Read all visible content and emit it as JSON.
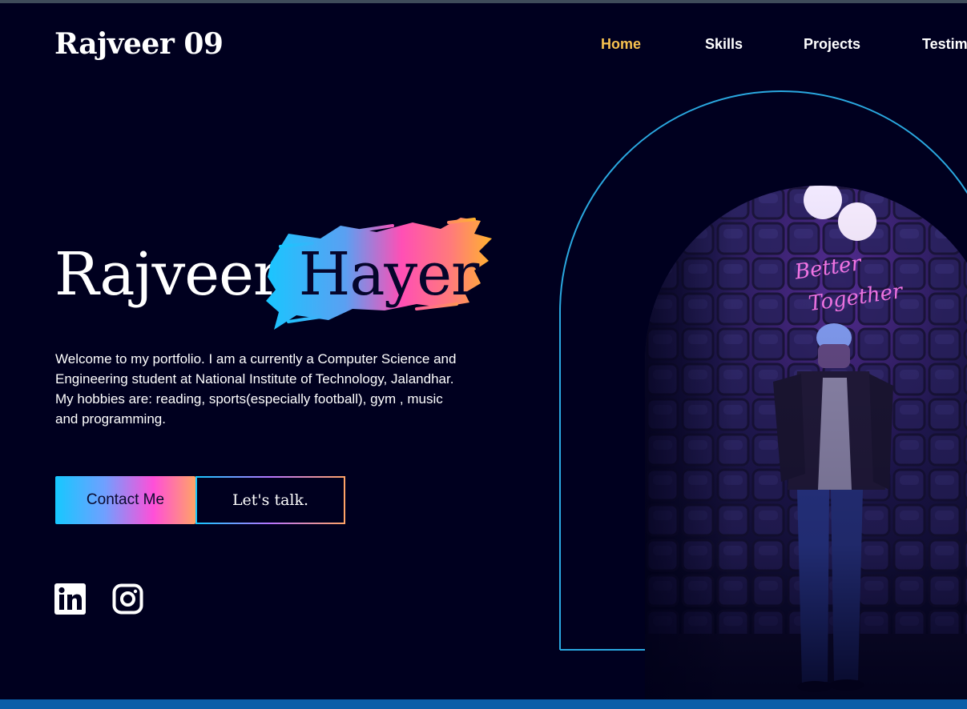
{
  "header": {
    "logo": "Rajveer 09",
    "nav": [
      {
        "label": "Home",
        "active": true
      },
      {
        "label": "Skills",
        "active": false
      },
      {
        "label": "Projects",
        "active": false
      },
      {
        "label": "Testim",
        "active": false
      }
    ]
  },
  "hero": {
    "first_name": "Rajveer",
    "last_name": "Hayer",
    "intro_lines": [
      "Welcome to my portfolio. I am a currently a Computer Science and Engineering student at National Institute of Technology, Jalandhar.",
      "My hobbies are: reading, sports(especially football), gym , music and programming."
    ],
    "contact_button": "Contact Me",
    "talk_button": "Let's talk.",
    "photo_sign": "Better Together"
  },
  "social": [
    {
      "icon": "linkedin-icon"
    },
    {
      "icon": "instagram-icon"
    }
  ],
  "colors": {
    "background": "#00001f",
    "accent_gold": "#f7c14f",
    "arch_stroke": "#2aa8e0",
    "gradient": [
      "#16c8ff",
      "#ff4fd8",
      "#ffa367"
    ]
  }
}
